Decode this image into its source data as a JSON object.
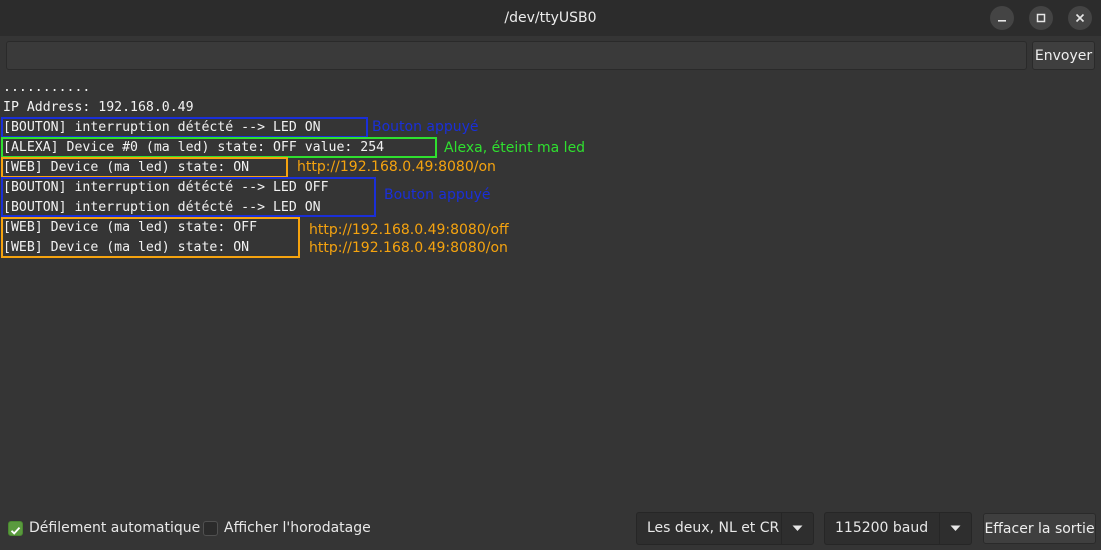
{
  "window": {
    "title": "/dev/ttyUSB0",
    "minimize_icon": "minimize-icon",
    "maximize_icon": "maximize-icon",
    "close_icon": "close-icon"
  },
  "send": {
    "input_value": "",
    "button_label": "Envoyer"
  },
  "output": {
    "lines": [
      "...........",
      "IP Address: 192.168.0.49",
      "[BOUTON] interruption détécté --> LED ON",
      "[ALEXA] Device #0 (ma led) state: OFF value: 254",
      "[WEB] Device (ma led) state: ON",
      "[BOUTON] interruption détécté --> LED OFF",
      "[BOUTON] interruption détécté --> LED ON",
      "[WEB] Device (ma led) state: OFF",
      "[WEB] Device (ma led) state: ON"
    ],
    "annotations": [
      {
        "text": "Bouton appuyé",
        "color": "#1a2fd8"
      },
      {
        "text": "Alexa, éteint ma led",
        "color": "#2fe02f"
      },
      {
        "text": "http://192.168.0.49:8080/on",
        "color": "#f5a30f"
      },
      {
        "text": "Bouton appuyé",
        "color": "#1a2fd8"
      },
      {
        "text": "http://192.168.0.49:8080/off",
        "color": "#f5a30f"
      },
      {
        "text": "http://192.168.0.49:8080/on",
        "color": "#f5a30f"
      }
    ],
    "box_colors": {
      "bouton": "#1a2fd8",
      "alexa": "#2fe02f",
      "web": "#f5a30f"
    }
  },
  "bottom": {
    "autoscroll": {
      "label": "Défilement automatique",
      "checked": true
    },
    "timestamp": {
      "label": "Afficher l'horodatage",
      "checked": false
    },
    "line_ending": {
      "selected": "Les deux, NL et CR"
    },
    "baud": {
      "selected": "115200 baud"
    },
    "clear_button": "Effacer la sortie",
    "accent": "#5a9a3e"
  }
}
